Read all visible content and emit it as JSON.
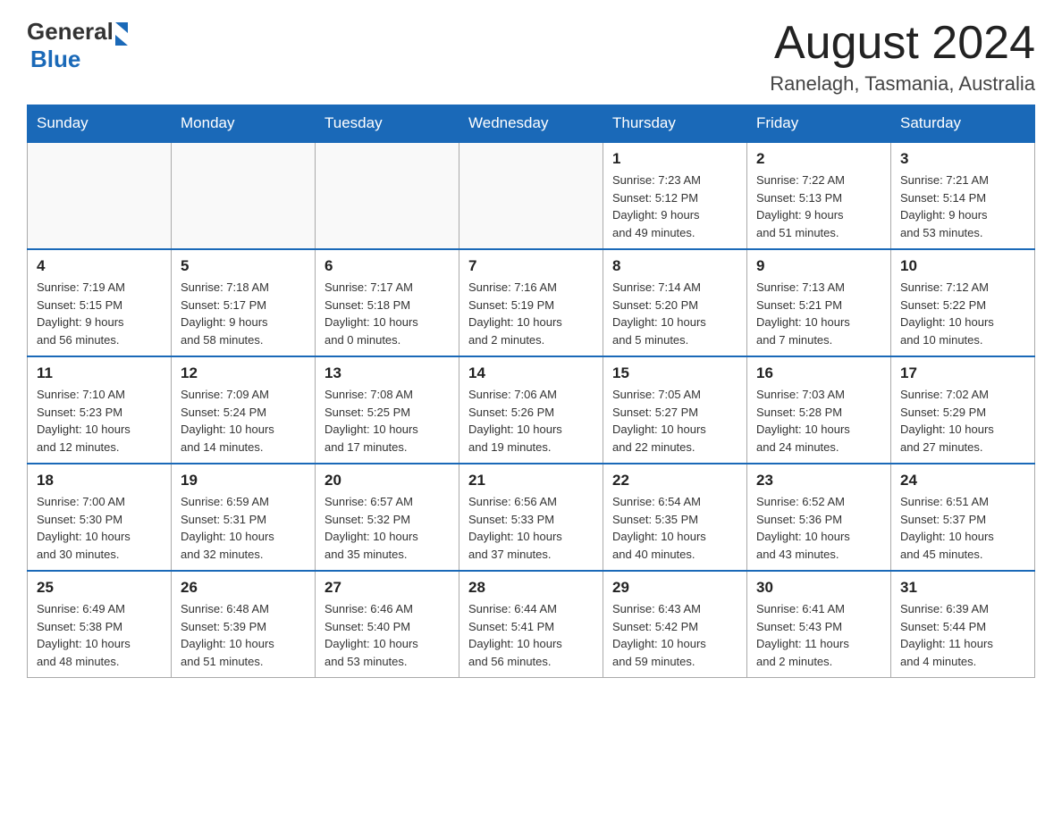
{
  "header": {
    "logo_general": "General",
    "logo_blue": "Blue",
    "month_title": "August 2024",
    "location": "Ranelagh, Tasmania, Australia"
  },
  "weekdays": [
    "Sunday",
    "Monday",
    "Tuesday",
    "Wednesday",
    "Thursday",
    "Friday",
    "Saturday"
  ],
  "weeks": [
    [
      {
        "day": "",
        "info": ""
      },
      {
        "day": "",
        "info": ""
      },
      {
        "day": "",
        "info": ""
      },
      {
        "day": "",
        "info": ""
      },
      {
        "day": "1",
        "info": "Sunrise: 7:23 AM\nSunset: 5:12 PM\nDaylight: 9 hours\nand 49 minutes."
      },
      {
        "day": "2",
        "info": "Sunrise: 7:22 AM\nSunset: 5:13 PM\nDaylight: 9 hours\nand 51 minutes."
      },
      {
        "day": "3",
        "info": "Sunrise: 7:21 AM\nSunset: 5:14 PM\nDaylight: 9 hours\nand 53 minutes."
      }
    ],
    [
      {
        "day": "4",
        "info": "Sunrise: 7:19 AM\nSunset: 5:15 PM\nDaylight: 9 hours\nand 56 minutes."
      },
      {
        "day": "5",
        "info": "Sunrise: 7:18 AM\nSunset: 5:17 PM\nDaylight: 9 hours\nand 58 minutes."
      },
      {
        "day": "6",
        "info": "Sunrise: 7:17 AM\nSunset: 5:18 PM\nDaylight: 10 hours\nand 0 minutes."
      },
      {
        "day": "7",
        "info": "Sunrise: 7:16 AM\nSunset: 5:19 PM\nDaylight: 10 hours\nand 2 minutes."
      },
      {
        "day": "8",
        "info": "Sunrise: 7:14 AM\nSunset: 5:20 PM\nDaylight: 10 hours\nand 5 minutes."
      },
      {
        "day": "9",
        "info": "Sunrise: 7:13 AM\nSunset: 5:21 PM\nDaylight: 10 hours\nand 7 minutes."
      },
      {
        "day": "10",
        "info": "Sunrise: 7:12 AM\nSunset: 5:22 PM\nDaylight: 10 hours\nand 10 minutes."
      }
    ],
    [
      {
        "day": "11",
        "info": "Sunrise: 7:10 AM\nSunset: 5:23 PM\nDaylight: 10 hours\nand 12 minutes."
      },
      {
        "day": "12",
        "info": "Sunrise: 7:09 AM\nSunset: 5:24 PM\nDaylight: 10 hours\nand 14 minutes."
      },
      {
        "day": "13",
        "info": "Sunrise: 7:08 AM\nSunset: 5:25 PM\nDaylight: 10 hours\nand 17 minutes."
      },
      {
        "day": "14",
        "info": "Sunrise: 7:06 AM\nSunset: 5:26 PM\nDaylight: 10 hours\nand 19 minutes."
      },
      {
        "day": "15",
        "info": "Sunrise: 7:05 AM\nSunset: 5:27 PM\nDaylight: 10 hours\nand 22 minutes."
      },
      {
        "day": "16",
        "info": "Sunrise: 7:03 AM\nSunset: 5:28 PM\nDaylight: 10 hours\nand 24 minutes."
      },
      {
        "day": "17",
        "info": "Sunrise: 7:02 AM\nSunset: 5:29 PM\nDaylight: 10 hours\nand 27 minutes."
      }
    ],
    [
      {
        "day": "18",
        "info": "Sunrise: 7:00 AM\nSunset: 5:30 PM\nDaylight: 10 hours\nand 30 minutes."
      },
      {
        "day": "19",
        "info": "Sunrise: 6:59 AM\nSunset: 5:31 PM\nDaylight: 10 hours\nand 32 minutes."
      },
      {
        "day": "20",
        "info": "Sunrise: 6:57 AM\nSunset: 5:32 PM\nDaylight: 10 hours\nand 35 minutes."
      },
      {
        "day": "21",
        "info": "Sunrise: 6:56 AM\nSunset: 5:33 PM\nDaylight: 10 hours\nand 37 minutes."
      },
      {
        "day": "22",
        "info": "Sunrise: 6:54 AM\nSunset: 5:35 PM\nDaylight: 10 hours\nand 40 minutes."
      },
      {
        "day": "23",
        "info": "Sunrise: 6:52 AM\nSunset: 5:36 PM\nDaylight: 10 hours\nand 43 minutes."
      },
      {
        "day": "24",
        "info": "Sunrise: 6:51 AM\nSunset: 5:37 PM\nDaylight: 10 hours\nand 45 minutes."
      }
    ],
    [
      {
        "day": "25",
        "info": "Sunrise: 6:49 AM\nSunset: 5:38 PM\nDaylight: 10 hours\nand 48 minutes."
      },
      {
        "day": "26",
        "info": "Sunrise: 6:48 AM\nSunset: 5:39 PM\nDaylight: 10 hours\nand 51 minutes."
      },
      {
        "day": "27",
        "info": "Sunrise: 6:46 AM\nSunset: 5:40 PM\nDaylight: 10 hours\nand 53 minutes."
      },
      {
        "day": "28",
        "info": "Sunrise: 6:44 AM\nSunset: 5:41 PM\nDaylight: 10 hours\nand 56 minutes."
      },
      {
        "day": "29",
        "info": "Sunrise: 6:43 AM\nSunset: 5:42 PM\nDaylight: 10 hours\nand 59 minutes."
      },
      {
        "day": "30",
        "info": "Sunrise: 6:41 AM\nSunset: 5:43 PM\nDaylight: 11 hours\nand 2 minutes."
      },
      {
        "day": "31",
        "info": "Sunrise: 6:39 AM\nSunset: 5:44 PM\nDaylight: 11 hours\nand 4 minutes."
      }
    ]
  ]
}
